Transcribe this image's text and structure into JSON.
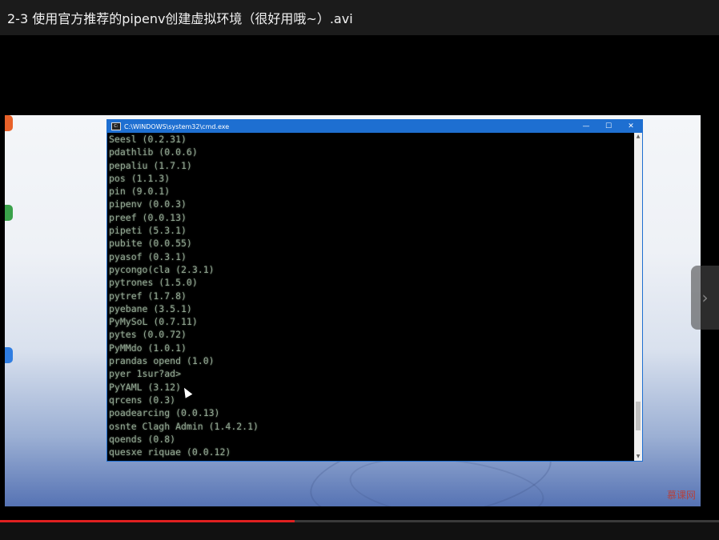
{
  "window_title": "2-3 使用官方推荐的pipenv创建虚拟环境（很好用哦~）.avi",
  "cmd": {
    "title": "C:\\WINDOWS\\system32\\cmd.exe",
    "lines": [
      "Seesl (0.2.31)",
      "pdathlib (0.0.6)",
      "pepaliu (1.7.1)",
      "pos (1.1.3)",
      "pin (9.0.1)",
      "pipenv (0.0.3)",
      "preef (0.0.13)",
      "pipeti (5.3.1)",
      "pubite (0.0.55)",
      "pyasof (0.3.1)",
      "pycongo(cla (2.3.1)",
      "pytrones (1.5.0)",
      "pytref (1.7.8)",
      "pyebane (3.5.1)",
      "PyMySoL (0.7.11)",
      "pytes (0.0.72)",
      "PyMMdo (1.0.1)",
      "prandas opend (1.0)",
      "pyer 1sur?ad>",
      "PyYAML (3.12)",
      "qrcens (0.3)",
      "poadearcing (0.0.13)",
      "osnte Clagh Admin (1.4.2.1)",
      "qoends (0.8)",
      "quesxe riquae (0.0.12)"
    ]
  },
  "watermark": "慕课网",
  "progress": 0.41,
  "controls": {
    "minimize": "—",
    "maximize": "☐",
    "close": "✕",
    "next": "›"
  }
}
